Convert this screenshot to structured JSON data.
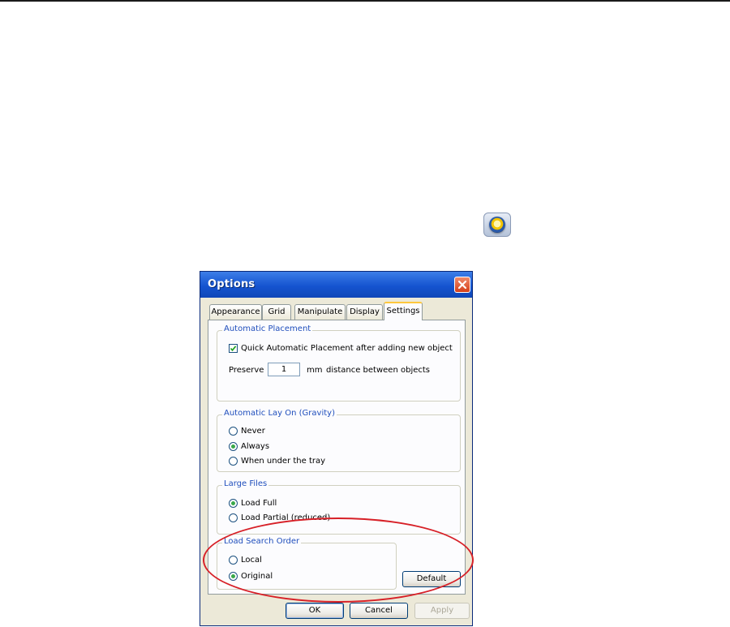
{
  "dialog": {
    "title": "Options",
    "tabs": [
      {
        "label": "Appearance"
      },
      {
        "label": "Grid"
      },
      {
        "label": "Manipulate"
      },
      {
        "label": "Display"
      },
      {
        "label": "Settings"
      }
    ],
    "active_tab": "Settings",
    "automatic_placement": {
      "legend": "Automatic Placement",
      "quick_checkbox_label": "Quick Automatic Placement after adding new object",
      "quick_checked": true,
      "preserve_label": "Preserve",
      "preserve_value": "1",
      "unit_label": "mm",
      "distance_label": "distance between objects"
    },
    "gravity": {
      "legend": "Automatic Lay On (Gravity)",
      "options": [
        "Never",
        "Always",
        "When under the tray"
      ],
      "selected": "Always"
    },
    "large_files": {
      "legend": "Large Files",
      "options": [
        "Load Full",
        "Load Partial (reduced)"
      ],
      "selected": "Load Full"
    },
    "search_order": {
      "legend": "Load Search Order",
      "options": [
        "Local",
        "Original"
      ],
      "selected": "Original",
      "default_button": "Default"
    },
    "buttons": {
      "ok": "OK",
      "cancel": "Cancel",
      "apply": "Apply"
    }
  },
  "colors": {
    "title_bar": "#1554d0",
    "group_legend": "#1f4ebc",
    "radio_dot": "#3aa84a",
    "highlight": "#d72027"
  },
  "icons": {
    "toolbar_icon": "options-icon",
    "close": "close-icon"
  }
}
